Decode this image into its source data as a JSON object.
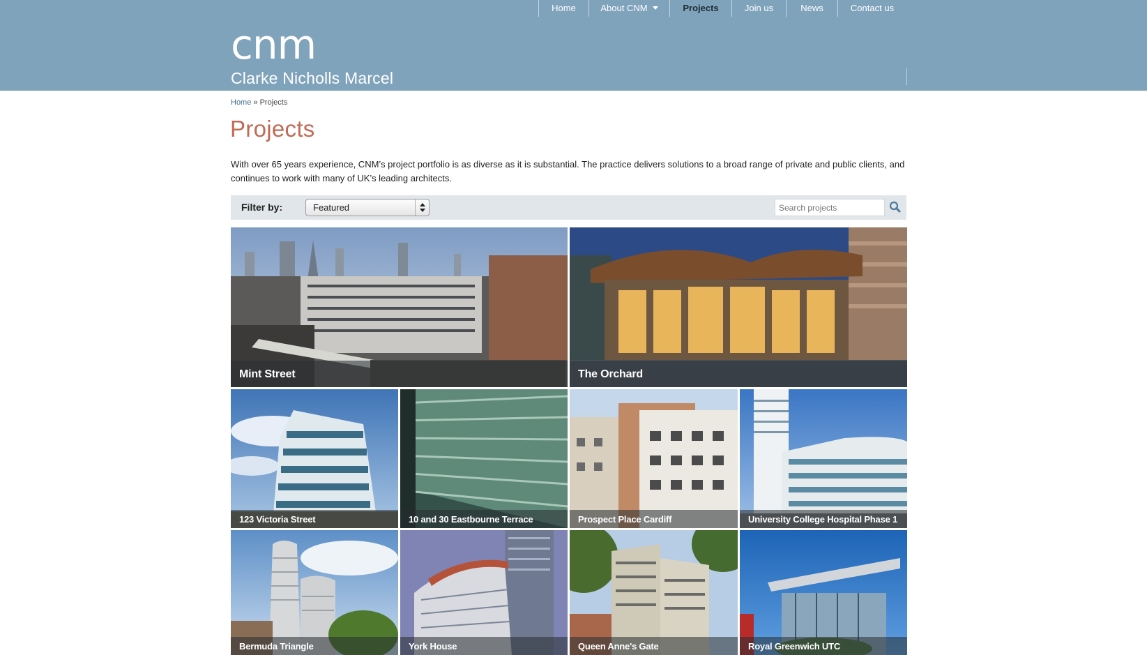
{
  "header": {
    "logo_mark": "cnm",
    "logo_name": "Clarke Nicholls Marcel",
    "nav": [
      {
        "label": "Home"
      },
      {
        "label": "About CNM"
      },
      {
        "label": "Projects"
      },
      {
        "label": "Join us"
      },
      {
        "label": "News"
      },
      {
        "label": "Contact us"
      }
    ]
  },
  "breadcrumb": {
    "home": "Home",
    "separator": "»",
    "current": "Projects"
  },
  "page": {
    "title": "Projects",
    "intro": "With over 65 years experience, CNM’s project portfolio is as diverse as it is substantial.  The practice delivers solutions to a broad range of private and public clients, and continues to work with many of UK’s leading architects."
  },
  "filter": {
    "label": "Filter by:",
    "selected": "Featured",
    "search_placeholder": "Search projects"
  },
  "projects": [
    {
      "name": "Mint Street"
    },
    {
      "name": "The Orchard"
    },
    {
      "name": "123 Victoria Street"
    },
    {
      "name": "10 and 30 Eastbourne Terrace"
    },
    {
      "name": "Prospect Place Cardiff"
    },
    {
      "name": "University College Hospital Phase 1"
    },
    {
      "name": "Bermuda Triangle"
    },
    {
      "name": "York House"
    },
    {
      "name": "Queen Anne's Gate"
    },
    {
      "name": "Royal Greenwich UTC"
    }
  ],
  "colors": {
    "header_bg": "#80a3bc",
    "title": "#c06a55",
    "link": "#3d6f94",
    "filter_bg": "#e1e6ea"
  }
}
